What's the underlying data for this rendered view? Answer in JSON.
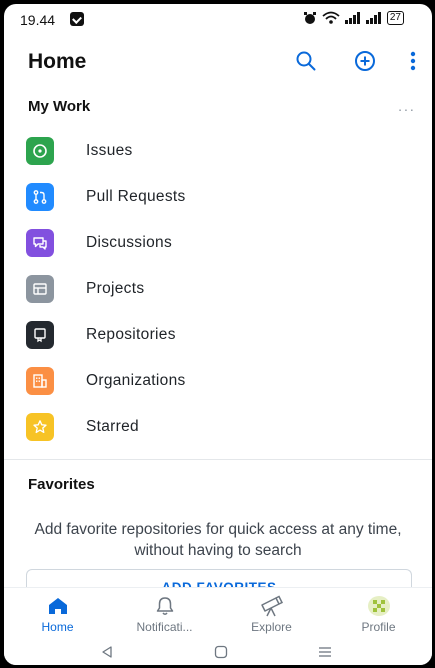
{
  "status_bar": {
    "time": "19.44",
    "battery": "27"
  },
  "header": {
    "title": "Home"
  },
  "my_work": {
    "title": "My Work",
    "more": "...",
    "items": [
      {
        "label": "Issues",
        "icon": "issue-opened-icon",
        "color": "#2da44e"
      },
      {
        "label": "Pull Requests",
        "icon": "git-pull-request-icon",
        "color": "#218bff"
      },
      {
        "label": "Discussions",
        "icon": "comment-discussion-icon",
        "color": "#8250df"
      },
      {
        "label": "Projects",
        "icon": "table-icon",
        "color": "#8c959f"
      },
      {
        "label": "Repositories",
        "icon": "repo-icon",
        "color": "#24292f"
      },
      {
        "label": "Organizations",
        "icon": "organization-icon",
        "color": "#fb8f44"
      },
      {
        "label": "Starred",
        "icon": "star-icon",
        "color": "#f7c325"
      }
    ]
  },
  "favorites": {
    "title": "Favorites",
    "description": "Add favorite repositories for quick access at any time, without having to search",
    "button": "ADD FAVORITES"
  },
  "bottom_nav": {
    "tabs": [
      {
        "label": "Home",
        "icon": "home-icon",
        "active": true
      },
      {
        "label": "Notificati...",
        "icon": "bell-icon",
        "active": false
      },
      {
        "label": "Explore",
        "icon": "telescope-icon",
        "active": false
      },
      {
        "label": "Profile",
        "icon": "avatar-icon",
        "active": false
      }
    ]
  },
  "colors": {
    "accent": "#0969da",
    "text": "#1f2328",
    "muted": "#6e7781"
  }
}
